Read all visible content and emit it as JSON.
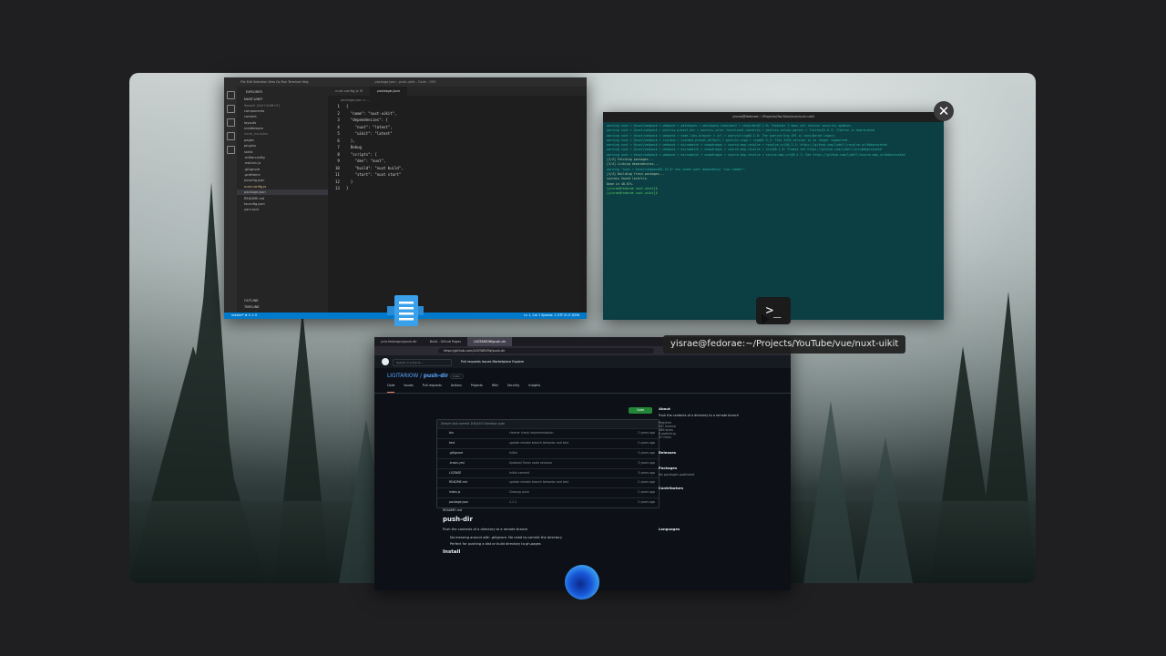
{
  "vscode": {
    "title": "package.json - push-uikit - Code - OSS",
    "menu": "File  Edit  Selection  View  Go  Run  Terminal  Help",
    "explorer_header": "EXPLORER",
    "project_name": "NUXT-UIKIT",
    "search_hint": "Search (Ctrl+Shift+F)",
    "files": [
      "components",
      "content",
      "layouts",
      "middleware",
      "node_modules",
      "pages",
      "plugins",
      "static",
      ".editorconfig",
      ".eslintrc.js",
      ".gitignore",
      ".prettierrc",
      "jsconfig.json",
      "nuxt.config.js",
      "package.json",
      "README.md",
      "tsconfig.json",
      "yarn.lock"
    ],
    "outline": "OUTLINE",
    "timeline": "TIMELINE",
    "tabs": [
      "nuxt.config.js M",
      "package.json"
    ],
    "breadcrumb": "package.json > ...",
    "code_lines": [
      "{",
      "  \"name\": \"nuxt-uikit\",",
      "  \"dependencies\": {",
      "    \"nuxt\": \"latest\",",
      "    \"uikit\": \"latest\"",
      "  },",
      "  Debug",
      "  \"scripts\": {",
      "    \"dev\": \"nuxt\",",
      "    \"build\": \"nuxt build\",",
      "    \"start\": \"nuxt start\"",
      "  }",
      "}"
    ],
    "status_left": "master*  ⊗ 0 ⚠ 0",
    "status_right": "Ln 1, Col 1   Spaces: 2   UTF-8   LF   JSON"
  },
  "terminal": {
    "title": "yisrae@fedorae:~/Projects/YouTube/vue/nuxt-uikit",
    "lines": [
      "warning nuxt > @nuxt/webpack > webpack > watchpack > watchpack-chokidar2 > chokidar@2.1.8: Chokidar 2 does not receive security updates",
      "warning nuxt > @nuxt/webpack > postcss-preset-env > postcss-color-functional-notation > postcss-values-parser > flatten@1.0.3: flatten is deprecated",
      "warning nuxt > @nuxt/webpack > webpack > node-libs-browser > url > querystring@0.2.0: The querystring API is considered Legacy.",
      "warning nuxt > @nuxt/webpack > cssnano > cssnano-preset-default > postcss-svgo > svgo@1.3.2: This SVGO version is no longer supported.",
      "warning nuxt > @nuxt/webpack > webpack > micromatch > snapdragon > source-map-resolve > resolve-url@0.2.1: https://github.com/lydell/resolve-url#deprecated",
      "warning nuxt > @nuxt/webpack > webpack > micromatch > snapdragon > source-map-resolve > urix@0.1.0: Please see https://github.com/lydell/urix#deprecated",
      "warning nuxt > @nuxt/webpack > webpack > micromatch > snapdragon > source-map-resolve > source-map-url@0.4.1: See https://github.com/lydell/source-map-url#deprecated",
      "[2/4] Fetching packages...",
      "[3/4] Linking dependencies...",
      "warning \"nuxt > @nuxt/webpack@2.15.8\" has unmet peer dependency \"vue-loader\".",
      "[4/4] Building fresh packages...",
      "success Saved lockfile.",
      "Done in 48.67s."
    ],
    "prompt1": "[yisrae@fedorae nuxt-uikit]$",
    "prompt2": "[yisrae@fedorae nuxt-uikit]$"
  },
  "close_label": "✕",
  "tooltip": "yisrae@fedorae:~/Projects/YouTube/vue/nuxt-uikit",
  "browser": {
    "tabs": [
      "ycle-fedorapro/push-dir",
      "Build - Github Pages",
      "LIGITARIOW/push-dir"
    ],
    "url": "https://github.com/LIGITARIOW/push-dir",
    "search_placeholder": "Search or jump to...",
    "nav": "Pull requests   Issues   Marketplace   Explore",
    "repo_owner": "LIGITARIOW",
    "repo_name": "push-dir",
    "repo_badge": "Public",
    "repo_tabs": [
      "Code",
      "Issues",
      "Pull requests",
      "Actions",
      "Projects",
      "Wiki",
      "Security",
      "Insights"
    ],
    "code_button": "Code",
    "commit_line": "lkhevin  last commit 1f1b143  Checkout push",
    "files": [
      {
        "name": "bin",
        "msg": "cleaner check implementation",
        "time": "2 years ago"
      },
      {
        "name": "test",
        "msg": "update remote branch behavior and test",
        "time": "2 years ago"
      },
      {
        "name": ".gitignore",
        "msg": "Initial",
        "time": "3 years ago"
      },
      {
        "name": ".travis.yml",
        "msg": "Updated Travis node versions",
        "time": "3 years ago"
      },
      {
        "name": "LICENSE",
        "msg": "Initial commit",
        "time": "3 years ago"
      },
      {
        "name": "README.md",
        "msg": "update remote branch behavior and test",
        "time": "2 years ago"
      },
      {
        "name": "index.js",
        "msg": "Cleanup push",
        "time": "2 years ago"
      },
      {
        "name": "package.json",
        "msg": "1.1.1",
        "time": "2 years ago"
      }
    ],
    "readme_file": "README.md",
    "readme_title": "push-dir",
    "readme_desc": "Push the contents of a directory to a remote branch",
    "readme_b1": "No messing around with .gitignore. No need to commit the directory",
    "readme_b2": "Perfect for pushing a dist or build directory to gh-pages",
    "readme_install": "Install",
    "about_title": "About",
    "about_desc": "Push the contents of a directory to a remote branch",
    "about_items": [
      "Readme",
      "MIT license",
      "486 stars",
      "8 watching",
      "37 forks"
    ],
    "releases": "Releases",
    "packages": "Packages",
    "packages_none": "No packages published",
    "contributors": "Contributors",
    "languages": "Languages"
  },
  "colors": {
    "vscode_status": "#007acc",
    "terminal_bg": "#0b3f44",
    "github_bg": "#0d1117"
  }
}
